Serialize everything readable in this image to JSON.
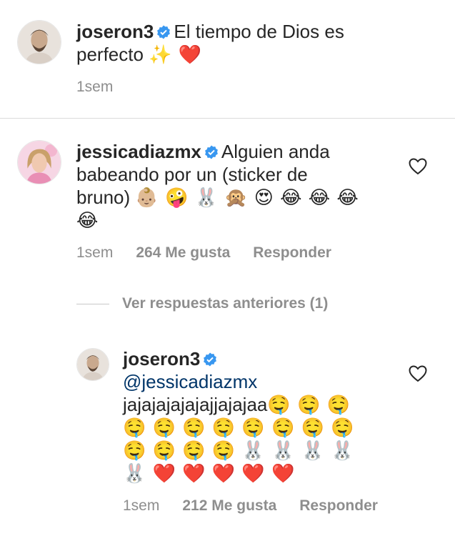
{
  "caption": {
    "username": "joseron3",
    "text": "El tiempo de Dios es perfecto",
    "emojis": "✨ ❤️",
    "time": "1sem"
  },
  "comment": {
    "username": "jessicadiazmx",
    "line1": "Alguien anda",
    "line2": "babeando por un (sticker de",
    "line3_text": "bruno)",
    "line3_emojis": "👶🏼 🤪 🐰 🙊 😍 😂 😂 😂",
    "line4_emojis": "😂",
    "time": "1sem",
    "likes": "264 Me gusta",
    "reply": "Responder"
  },
  "view_previous": "Ver respuestas anteriores (1)",
  "reply": {
    "username": "joseron3",
    "mention": "@jessicadiazmx",
    "line3_text": "jajajajajajajjajajaa",
    "line3_emojis": "🤤 🤤 🤤",
    "line4_emojis": "🤤 🤤 🤤 🤤 🤤 🤤 🤤 🤤",
    "line5_emojis": "🤤 🤤 🤤 🤤 🐰 🐰 🐰 🐰",
    "line6_emojis": "🐰 ❤️ ❤️ ❤️ ❤️ ❤️",
    "time": "1sem",
    "likes": "212 Me gusta",
    "reply": "Responder"
  },
  "icons": {
    "verified": "verified-badge-icon",
    "like": "heart-outline-icon"
  },
  "colors": {
    "verified": "#3897f0",
    "mention": "#003569",
    "secondary": "#8e8e8e"
  }
}
